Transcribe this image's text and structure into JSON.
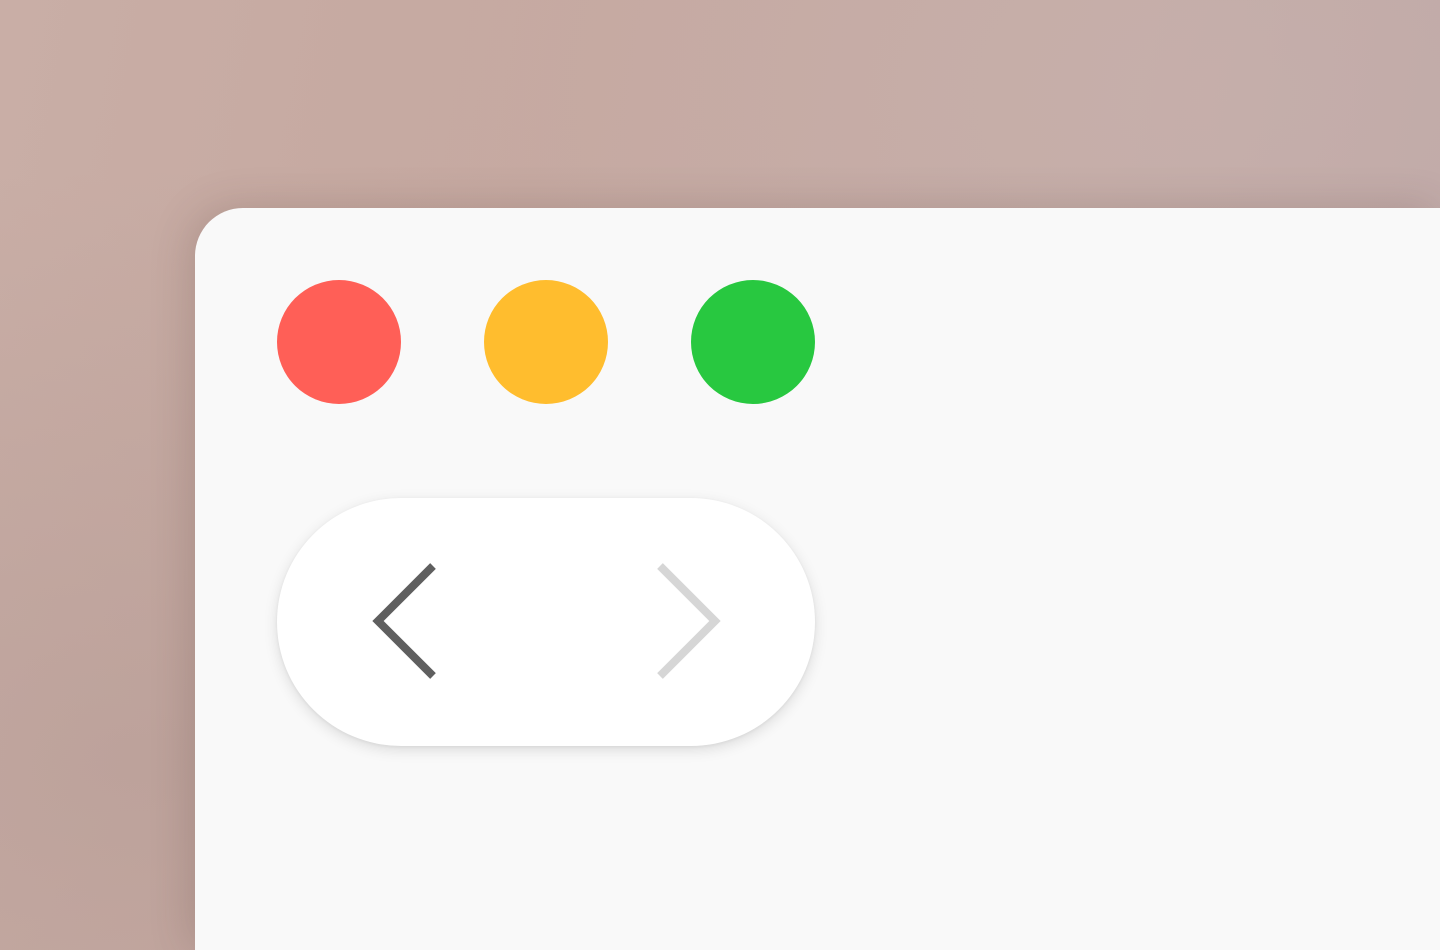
{
  "window": {
    "controls": {
      "close": {
        "icon": "close-circle-icon",
        "color": "#FF5F57"
      },
      "minimize": {
        "icon": "minimize-circle-icon",
        "color": "#FFBD2E"
      },
      "zoom": {
        "icon": "zoom-circle-icon",
        "color": "#28C840"
      }
    },
    "navigation": {
      "back": {
        "icon": "chevron-left-icon",
        "enabled": true,
        "color": "#5F5F5F"
      },
      "forward": {
        "icon": "chevron-right-icon",
        "enabled": false,
        "color": "#D6D6D6"
      }
    }
  }
}
